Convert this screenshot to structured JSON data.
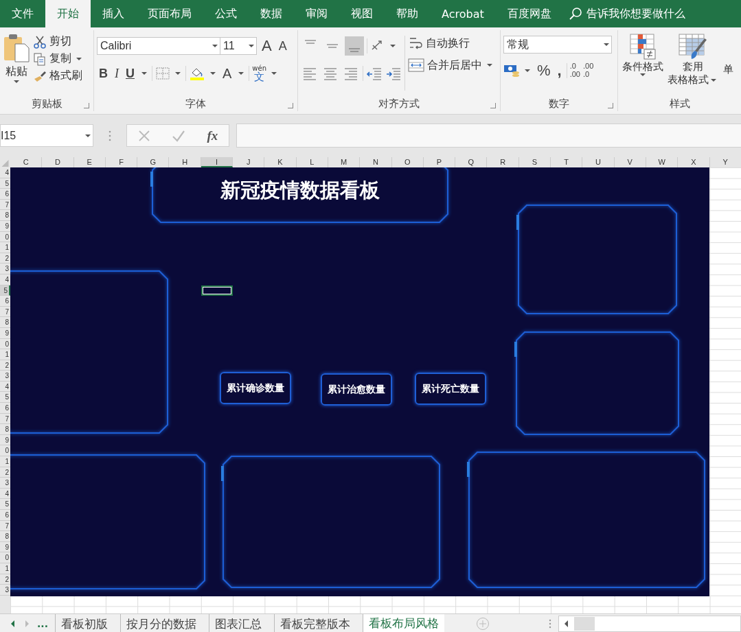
{
  "menu_tabs": [
    {
      "label": "文件",
      "selected": false
    },
    {
      "label": "开始",
      "selected": true
    },
    {
      "label": "插入",
      "selected": false
    },
    {
      "label": "页面布局",
      "selected": false
    },
    {
      "label": "公式",
      "selected": false
    },
    {
      "label": "数据",
      "selected": false
    },
    {
      "label": "审阅",
      "selected": false
    },
    {
      "label": "视图",
      "selected": false
    },
    {
      "label": "帮助",
      "selected": false
    },
    {
      "label": "Acrobat",
      "selected": false
    },
    {
      "label": "百度网盘",
      "selected": false
    }
  ],
  "tell_me": "告诉我你想要做什么",
  "clipboard": {
    "paste": "粘贴",
    "cut": "剪切",
    "copy": "复制",
    "format_painter": "格式刷",
    "group": "剪贴板"
  },
  "font": {
    "name": "Calibri",
    "size": "11",
    "grow": "A",
    "shrink": "A",
    "bold": "B",
    "italic": "I",
    "underline": "U",
    "font_color": "A",
    "phonetic_top": "wén",
    "phonetic_char": "文",
    "group": "字体"
  },
  "alignment": {
    "wrap": "自动换行",
    "merge": "合并后居中",
    "group": "对齐方式"
  },
  "number": {
    "format": "常规",
    "percent": "%",
    "comma": ",",
    "inc_decimal": [
      ".0",
      ".00"
    ],
    "dec_decimal": [
      ".00",
      ".0"
    ],
    "group": "数字"
  },
  "styles": {
    "conditional": "条件格式",
    "table_format_1": "套用",
    "table_format_2": "表格格式",
    "cell_styles": "单",
    "group": "样式"
  },
  "name_box": "I15",
  "fx": "fx",
  "columns": [
    {
      "label": "C",
      "selected": false
    },
    {
      "label": "D",
      "selected": false
    },
    {
      "label": "E",
      "selected": false
    },
    {
      "label": "F",
      "selected": false
    },
    {
      "label": "G",
      "selected": false
    },
    {
      "label": "H",
      "selected": false
    },
    {
      "label": "I",
      "selected": true
    },
    {
      "label": "J",
      "selected": false
    },
    {
      "label": "K",
      "selected": false
    },
    {
      "label": "L",
      "selected": false
    },
    {
      "label": "M",
      "selected": false
    },
    {
      "label": "N",
      "selected": false
    },
    {
      "label": "O",
      "selected": false
    },
    {
      "label": "P",
      "selected": false
    },
    {
      "label": "Q",
      "selected": false
    },
    {
      "label": "R",
      "selected": false
    },
    {
      "label": "S",
      "selected": false
    },
    {
      "label": "T",
      "selected": false
    },
    {
      "label": "U",
      "selected": false
    },
    {
      "label": "V",
      "selected": false
    },
    {
      "label": "W",
      "selected": false
    },
    {
      "label": "X",
      "selected": false
    },
    {
      "label": "Y",
      "selected": false
    }
  ],
  "rows": [
    {
      "label": "4",
      "selected": false
    },
    {
      "label": "5",
      "selected": false
    },
    {
      "label": "6",
      "selected": false
    },
    {
      "label": "7",
      "selected": false
    },
    {
      "label": "8",
      "selected": false
    },
    {
      "label": "9",
      "selected": false
    },
    {
      "label": "0",
      "selected": false
    },
    {
      "label": "1",
      "selected": false
    },
    {
      "label": "2",
      "selected": false
    },
    {
      "label": "3",
      "selected": false
    },
    {
      "label": "4",
      "selected": false
    },
    {
      "label": "5",
      "selected": true
    },
    {
      "label": "6",
      "selected": false
    },
    {
      "label": "7",
      "selected": false
    },
    {
      "label": "8",
      "selected": false
    },
    {
      "label": "9",
      "selected": false
    },
    {
      "label": "0",
      "selected": false
    },
    {
      "label": "1",
      "selected": false
    },
    {
      "label": "2",
      "selected": false
    },
    {
      "label": "3",
      "selected": false
    },
    {
      "label": "4",
      "selected": false
    },
    {
      "label": "5",
      "selected": false
    },
    {
      "label": "6",
      "selected": false
    },
    {
      "label": "7",
      "selected": false
    },
    {
      "label": "8",
      "selected": false
    },
    {
      "label": "9",
      "selected": false
    },
    {
      "label": "0",
      "selected": false
    },
    {
      "label": "1",
      "selected": false
    },
    {
      "label": "2",
      "selected": false
    },
    {
      "label": "3",
      "selected": false
    },
    {
      "label": "4",
      "selected": false
    },
    {
      "label": "5",
      "selected": false
    },
    {
      "label": "6",
      "selected": false
    },
    {
      "label": "7",
      "selected": false
    },
    {
      "label": "8",
      "selected": false
    },
    {
      "label": "9",
      "selected": false
    },
    {
      "label": "0",
      "selected": false
    },
    {
      "label": "1",
      "selected": false
    },
    {
      "label": "2",
      "selected": false
    },
    {
      "label": "3",
      "selected": false
    }
  ],
  "dashboard": {
    "title": "新冠疫情数据看板",
    "labels": [
      "累计确诊数量",
      "累计治愈数量",
      "累计死亡数量"
    ]
  },
  "sheet_more": "...",
  "sheet_tabs": [
    {
      "label": "看板初版",
      "selected": false
    },
    {
      "label": "按月分的数据",
      "selected": false
    },
    {
      "label": "图表汇总",
      "selected": false
    },
    {
      "label": "看板完整版本",
      "selected": false
    },
    {
      "label": "看板布局风格",
      "selected": true
    }
  ]
}
